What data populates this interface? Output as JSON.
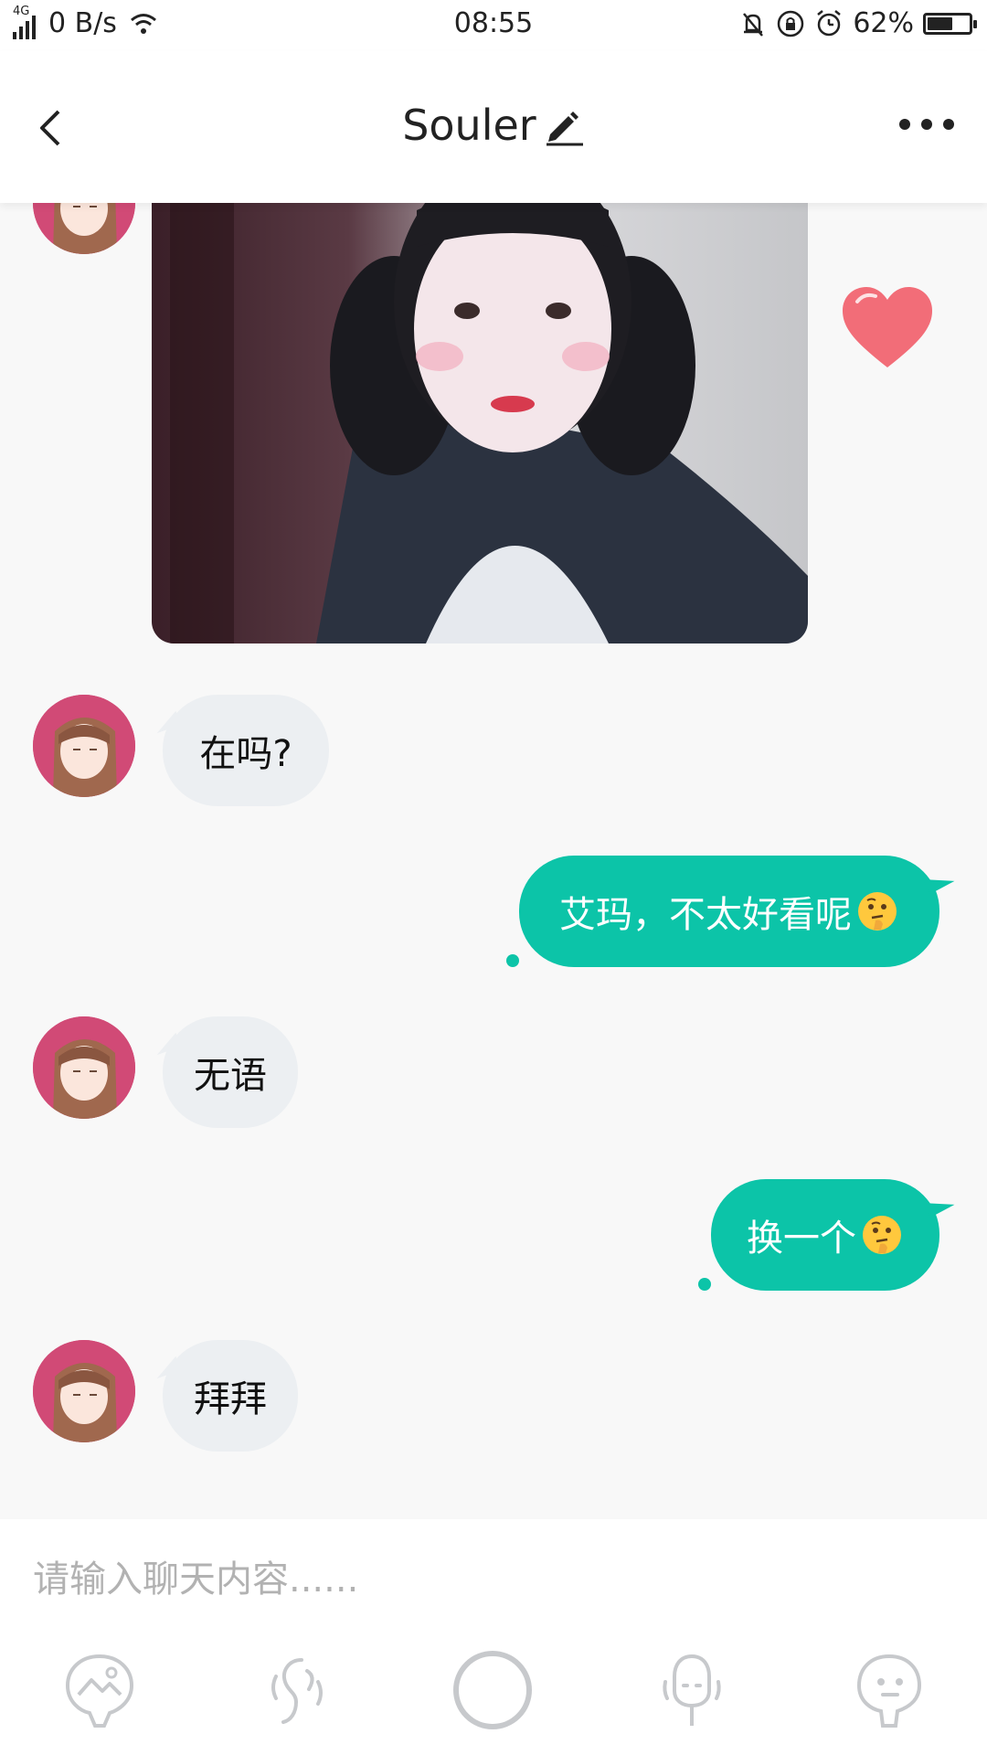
{
  "status_bar": {
    "network": "4G",
    "speed": "0 B/s",
    "time": "08:55",
    "battery": "62%",
    "battery_level": 0.62
  },
  "header": {
    "title": "Souler"
  },
  "messages": [
    {
      "side": "in",
      "kind": "image"
    },
    {
      "side": "in",
      "text": "在吗?"
    },
    {
      "side": "out",
      "text": "艾玛，不太好看呢"
    },
    {
      "side": "in",
      "text": "无语"
    },
    {
      "side": "out",
      "text": "换一个"
    },
    {
      "side": "in",
      "text": "拜拜"
    }
  ],
  "input": {
    "placeholder": "请输入聊天内容......"
  },
  "toolbar": {
    "items": [
      "image-icon",
      "voice-icon",
      "record-button",
      "microphone-icon",
      "emoji-icon"
    ]
  },
  "colors": {
    "accent": "#0cc4a8",
    "incoming_bubble": "#eceff2",
    "avatar_bg": "#d14a76",
    "heart": "#f26d78"
  }
}
